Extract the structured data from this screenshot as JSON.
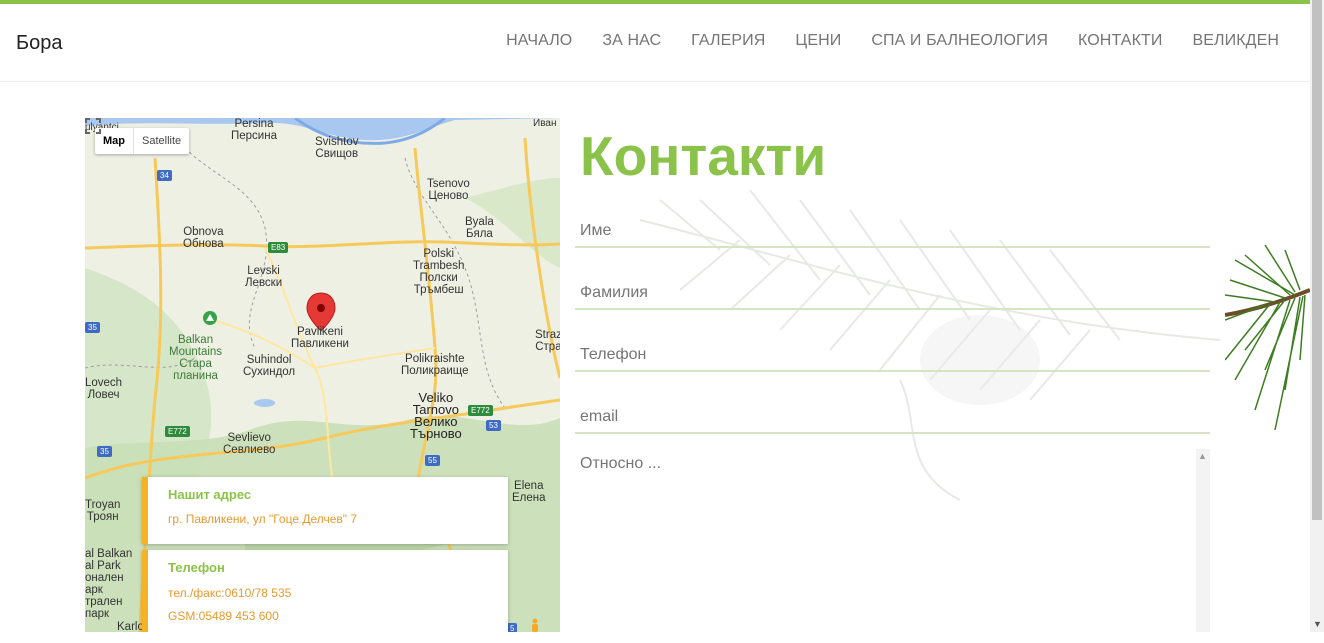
{
  "brand": "Бора",
  "nav": [
    "НАЧАЛО",
    "ЗА НАС",
    "ГАЛЕРИЯ",
    "ЦЕНИ",
    "СПА И БАЛНЕОЛОГИЯ",
    "КОНТАКТИ",
    "ВЕЛИКДЕН"
  ],
  "map": {
    "type_buttons": {
      "map": "Map",
      "satellite": "Satellite"
    },
    "labels": {
      "persina": "Persina",
      "persina_bg": "Персина",
      "svishtov": "Svishtov",
      "svishtov_bg": "Свищов",
      "tsenovo": "Tsenovo",
      "tsenovo_bg": "Ценово",
      "byala": "Byala",
      "byala_bg": "Бяла",
      "obnova": "Obnova",
      "obnova_bg": "Обнова",
      "levski": "Levski",
      "levski_bg": "Левски",
      "polski": "Polski",
      "polski_bg1": "Trambesh",
      "polski_bg2": "Полски",
      "polski_bg3": "Тръмбеш",
      "pavlikeni": "Pavlikeni",
      "pavlikeni_bg": "Павликени",
      "balkan1": "Balkan",
      "balkan2": "Mountains",
      "balkan3": "Стара",
      "balkan4": "планина",
      "suhindol": "Suhindol",
      "suhindol_bg": "Сухиндол",
      "polikraishte": "Polikraishte",
      "polikraishte_bg": "Поликраище",
      "lovech": "Lovech",
      "lovech_bg": "Ловеч",
      "veliko1": "Veliko",
      "veliko2": "Tarnovo",
      "veliko3": "Велико",
      "veliko4": "Търново",
      "sevlievo": "Sevlievo",
      "sevlievo_bg": "Севлиево",
      "troyan": "Troyan",
      "troyan_bg": "Троян",
      "elena": "Elena",
      "elena_bg": "Елена",
      "straz": "Straz",
      "straz_bg": "Стра",
      "ulyanci": "ulyantci",
      "ivan": "Иван",
      "park1": "al Balkan",
      "park2": "al Park",
      "park3": "оналeн",
      "park4": "арк",
      "park5": "тралeн",
      "park6": "парк",
      "karlo": "Karlo"
    },
    "shields": [
      "34",
      "E83",
      "35",
      "E772",
      "E772",
      "53",
      "35",
      "55",
      "5"
    ]
  },
  "address_card": {
    "title": "Нашит адрес",
    "line": "гр. Павликени, ул \"Гоце Делчев\" 7"
  },
  "phone_card": {
    "title": "Телефон",
    "line1": "тел./факс:0610/78 535",
    "line2": "GSM:05489 453 600"
  },
  "contact": {
    "heading": "Контакти",
    "fields": {
      "first_name": "Име",
      "last_name": "Фамилия",
      "phone": "Телефон",
      "email": "email",
      "message": "Относно ..."
    }
  },
  "colors": {
    "accent": "#8bc34a",
    "card_border": "#f5b323",
    "card_text": "#e59a2e"
  }
}
